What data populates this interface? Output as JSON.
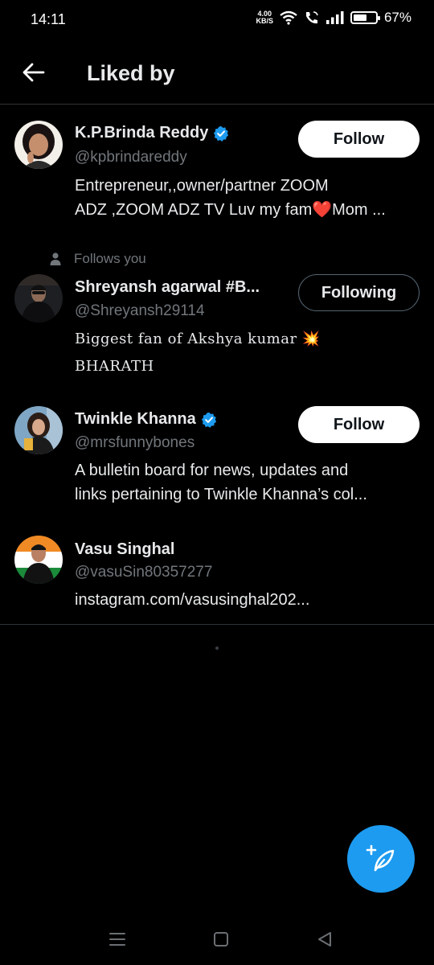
{
  "status_bar": {
    "time": "14:11",
    "net_speed_value": "4.00",
    "net_speed_unit": "KB/S",
    "battery_percent": "67%",
    "battery_level": 0.67
  },
  "header": {
    "title": "Liked by"
  },
  "users": [
    {
      "name": "K.P.Brinda Reddy",
      "verified": true,
      "handle": "@kpbrindareddy",
      "bio_lines": [
        "Entrepreneur,,owner/partner ZOOM",
        "ADZ ,ZOOM ADZ TV Luv my fam❤️Mom ..."
      ],
      "button": "Follow"
    },
    {
      "context": "Follows you",
      "name": "Shreyansh agarwal #B...",
      "verified": false,
      "handle": "@Shreyansh29114",
      "bio_lines": [
        "Biggest fan of Akshya kumar 💥",
        "BHARATH"
      ],
      "button": "Following"
    },
    {
      "name": "Twinkle Khanna",
      "verified": true,
      "handle": "@mrsfunnybones",
      "bio_lines": [
        "A bulletin board for news, updates and",
        "links pertaining to Twinkle Khanna’s col..."
      ],
      "button": "Follow"
    },
    {
      "name": "Vasu Singhal",
      "verified": false,
      "handle": "@vasuSin80357277",
      "bio_lines": [
        "instagram.com/vasusinghal202..."
      ]
    }
  ],
  "colors": {
    "background": "#000000",
    "accent": "#1d9bf0",
    "secondary_text": "#71767b",
    "verified_badge": "#1d9bf0"
  },
  "icons": {
    "back": "arrow-left",
    "verified": "verified-badge",
    "follows_you": "person",
    "compose": "feather-plus",
    "nav_recents": "menu-lines",
    "nav_home": "square",
    "nav_back": "triangle-left"
  }
}
